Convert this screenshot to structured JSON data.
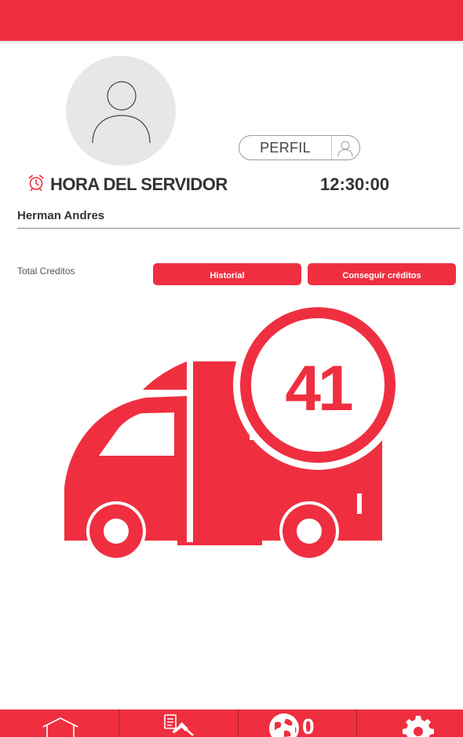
{
  "header": {},
  "profile": {
    "avatar_icon": "user-silhouette-icon",
    "perfil_label": "PERFIL",
    "perfil_icon": "user-outline-icon"
  },
  "server": {
    "label": "HORA DEL SERVIDOR",
    "time": "12:30:00",
    "icon": "alarm-clock-icon"
  },
  "user": {
    "name": "Herman Andres"
  },
  "credits": {
    "label": "Total Creditos",
    "count": "41",
    "historial_label": "Historial",
    "conseguir_label": "Conseguir créditos",
    "illustration_icon": "delivery-truck-icon"
  },
  "bottom_nav": {
    "items": [
      {
        "icon": "home-icon"
      },
      {
        "icon": "auction-list-icon"
      },
      {
        "icon": "globe-icon",
        "count": "0"
      },
      {
        "icon": "gear-icon"
      }
    ]
  },
  "colors": {
    "accent": "#ef2f40",
    "avatar_bg": "#e6e7e9",
    "text": "#333333"
  }
}
